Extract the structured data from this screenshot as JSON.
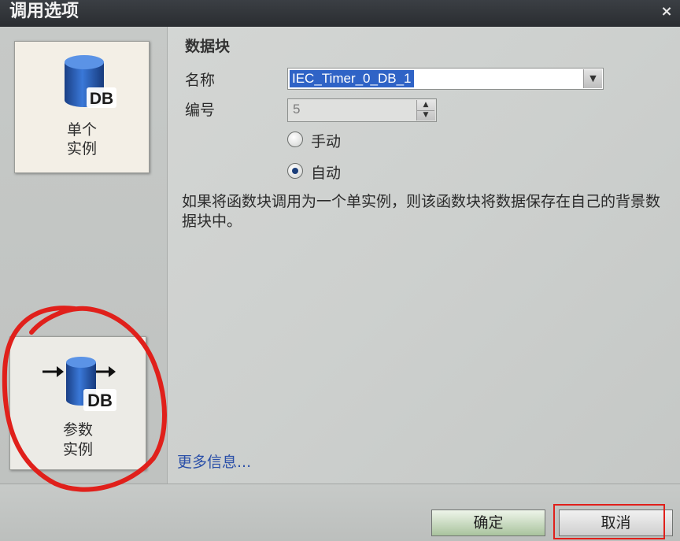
{
  "window": {
    "title": "调用选项",
    "close_glyph": "×"
  },
  "options": {
    "single_instance": {
      "line1": "单个",
      "line2": "实例",
      "icon_text": "DB"
    },
    "multi_instance": {
      "line1": "参数",
      "line2": "实例",
      "icon_text": "DB"
    }
  },
  "datablock": {
    "section_title": "数据块",
    "name_label": "名称",
    "name_value": "IEC_Timer_0_DB_1",
    "number_label": "编号",
    "number_value": "5",
    "radio_manual": "手动",
    "radio_auto": "自动",
    "selected_mode": "自动",
    "description": "如果将函数块调用为一个单实例，则该函数块将数据保存在自己的背景数据块中。"
  },
  "links": {
    "more_info": "更多信息..."
  },
  "buttons": {
    "ok": "确定",
    "cancel": "取消"
  },
  "colors": {
    "annotation_red": "#e0201b",
    "db_icon_blue": "#1d4fa0",
    "selection_blue": "#2f63c6"
  },
  "icons": [
    "database-icon",
    "arrow-in-icon",
    "arrow-out-icon",
    "chevron-down-icon",
    "spin-up-icon",
    "spin-down-icon",
    "close-icon"
  ]
}
